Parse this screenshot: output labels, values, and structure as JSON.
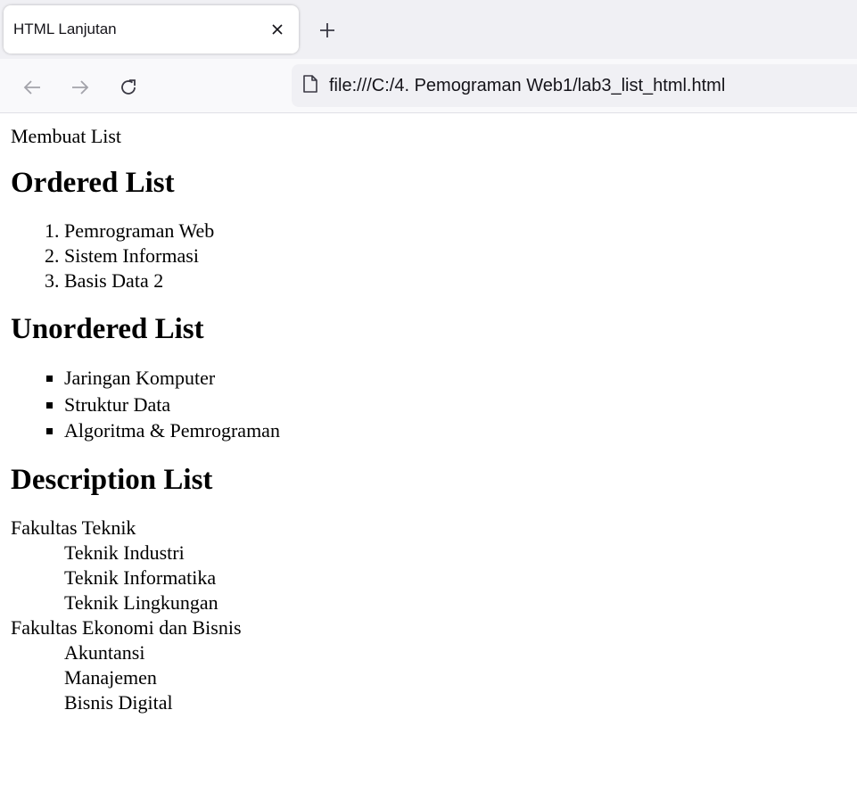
{
  "browser": {
    "tab_title": "HTML Lanjutan",
    "url": "file:///C:/4. Pemograman Web1/lab3_list_html.html"
  },
  "page": {
    "intro": "Membuat List",
    "ordered": {
      "heading": "Ordered List",
      "items": [
        "Pemrograman Web",
        "Sistem Informasi",
        "Basis Data 2"
      ]
    },
    "unordered": {
      "heading": "Unordered List",
      "items": [
        "Jaringan Komputer",
        "Struktur Data",
        "Algoritma & Pemrograman"
      ]
    },
    "description": {
      "heading": "Description List",
      "groups": [
        {
          "term": "Fakultas Teknik",
          "defs": [
            "Teknik Industri",
            "Teknik Informatika",
            "Teknik Lingkungan"
          ]
        },
        {
          "term": "Fakultas Ekonomi dan Bisnis",
          "defs": [
            "Akuntansi",
            "Manajemen",
            "Bisnis Digital"
          ]
        }
      ]
    }
  },
  "icons": {
    "close": "close-icon",
    "new_tab": "plus-icon",
    "back": "arrow-left-icon",
    "forward": "arrow-right-icon",
    "reload": "reload-icon",
    "file": "file-icon"
  }
}
